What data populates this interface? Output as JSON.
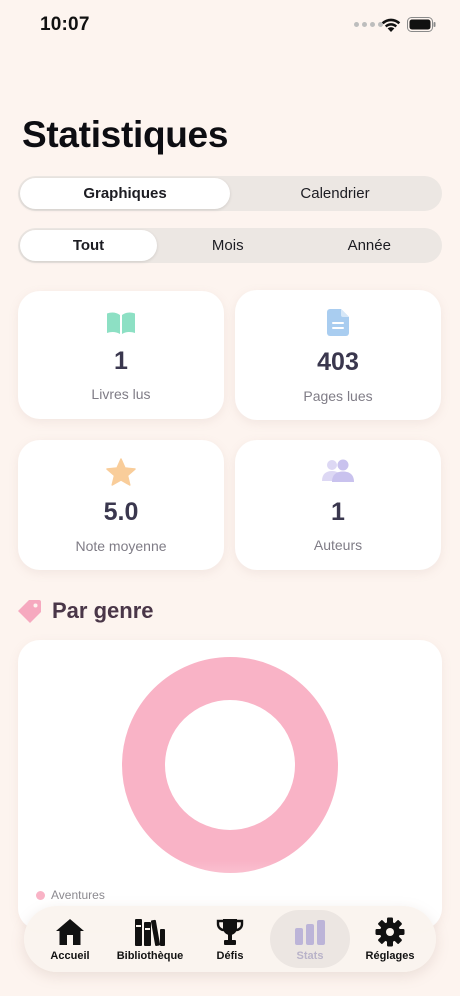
{
  "status_bar": {
    "time": "10:07"
  },
  "page": {
    "title": "Statistiques"
  },
  "view_switch": {
    "options": [
      "Graphiques",
      "Calendrier"
    ],
    "selected": "Graphiques"
  },
  "period_switch": {
    "options": [
      "Tout",
      "Mois",
      "Année"
    ],
    "selected": "Tout"
  },
  "stats": [
    {
      "icon": "open-book-icon",
      "value": "1",
      "label": "Livres lus",
      "color": "#8de0c4"
    },
    {
      "icon": "document-icon",
      "value": "403",
      "label": "Pages lues",
      "color": "#a9cdf0"
    },
    {
      "icon": "star-icon",
      "value": "5.0",
      "label": "Note moyenne",
      "color": "#f9cd9a"
    },
    {
      "icon": "people-icon",
      "value": "1",
      "label": "Auteurs",
      "color": "#c9c2ee"
    }
  ],
  "genre_section": {
    "title": "Par genre",
    "icon": "tag-icon",
    "icon_color": "#f6a9bf"
  },
  "chart_data": {
    "type": "pie",
    "style": "donut",
    "categories": [
      "Aventures"
    ],
    "values": [
      1
    ],
    "colors": [
      "#f9b3c6"
    ],
    "legend": "bottom-left"
  },
  "tab_bar": {
    "items": [
      {
        "label": "Accueil",
        "icon": "house-icon"
      },
      {
        "label": "Bibliothèque",
        "icon": "books-icon"
      },
      {
        "label": "Défis",
        "icon": "trophy-icon"
      },
      {
        "label": "Stats",
        "icon": "bar-chart-icon",
        "active": true
      },
      {
        "label": "Réglages",
        "icon": "gear-icon"
      }
    ]
  }
}
